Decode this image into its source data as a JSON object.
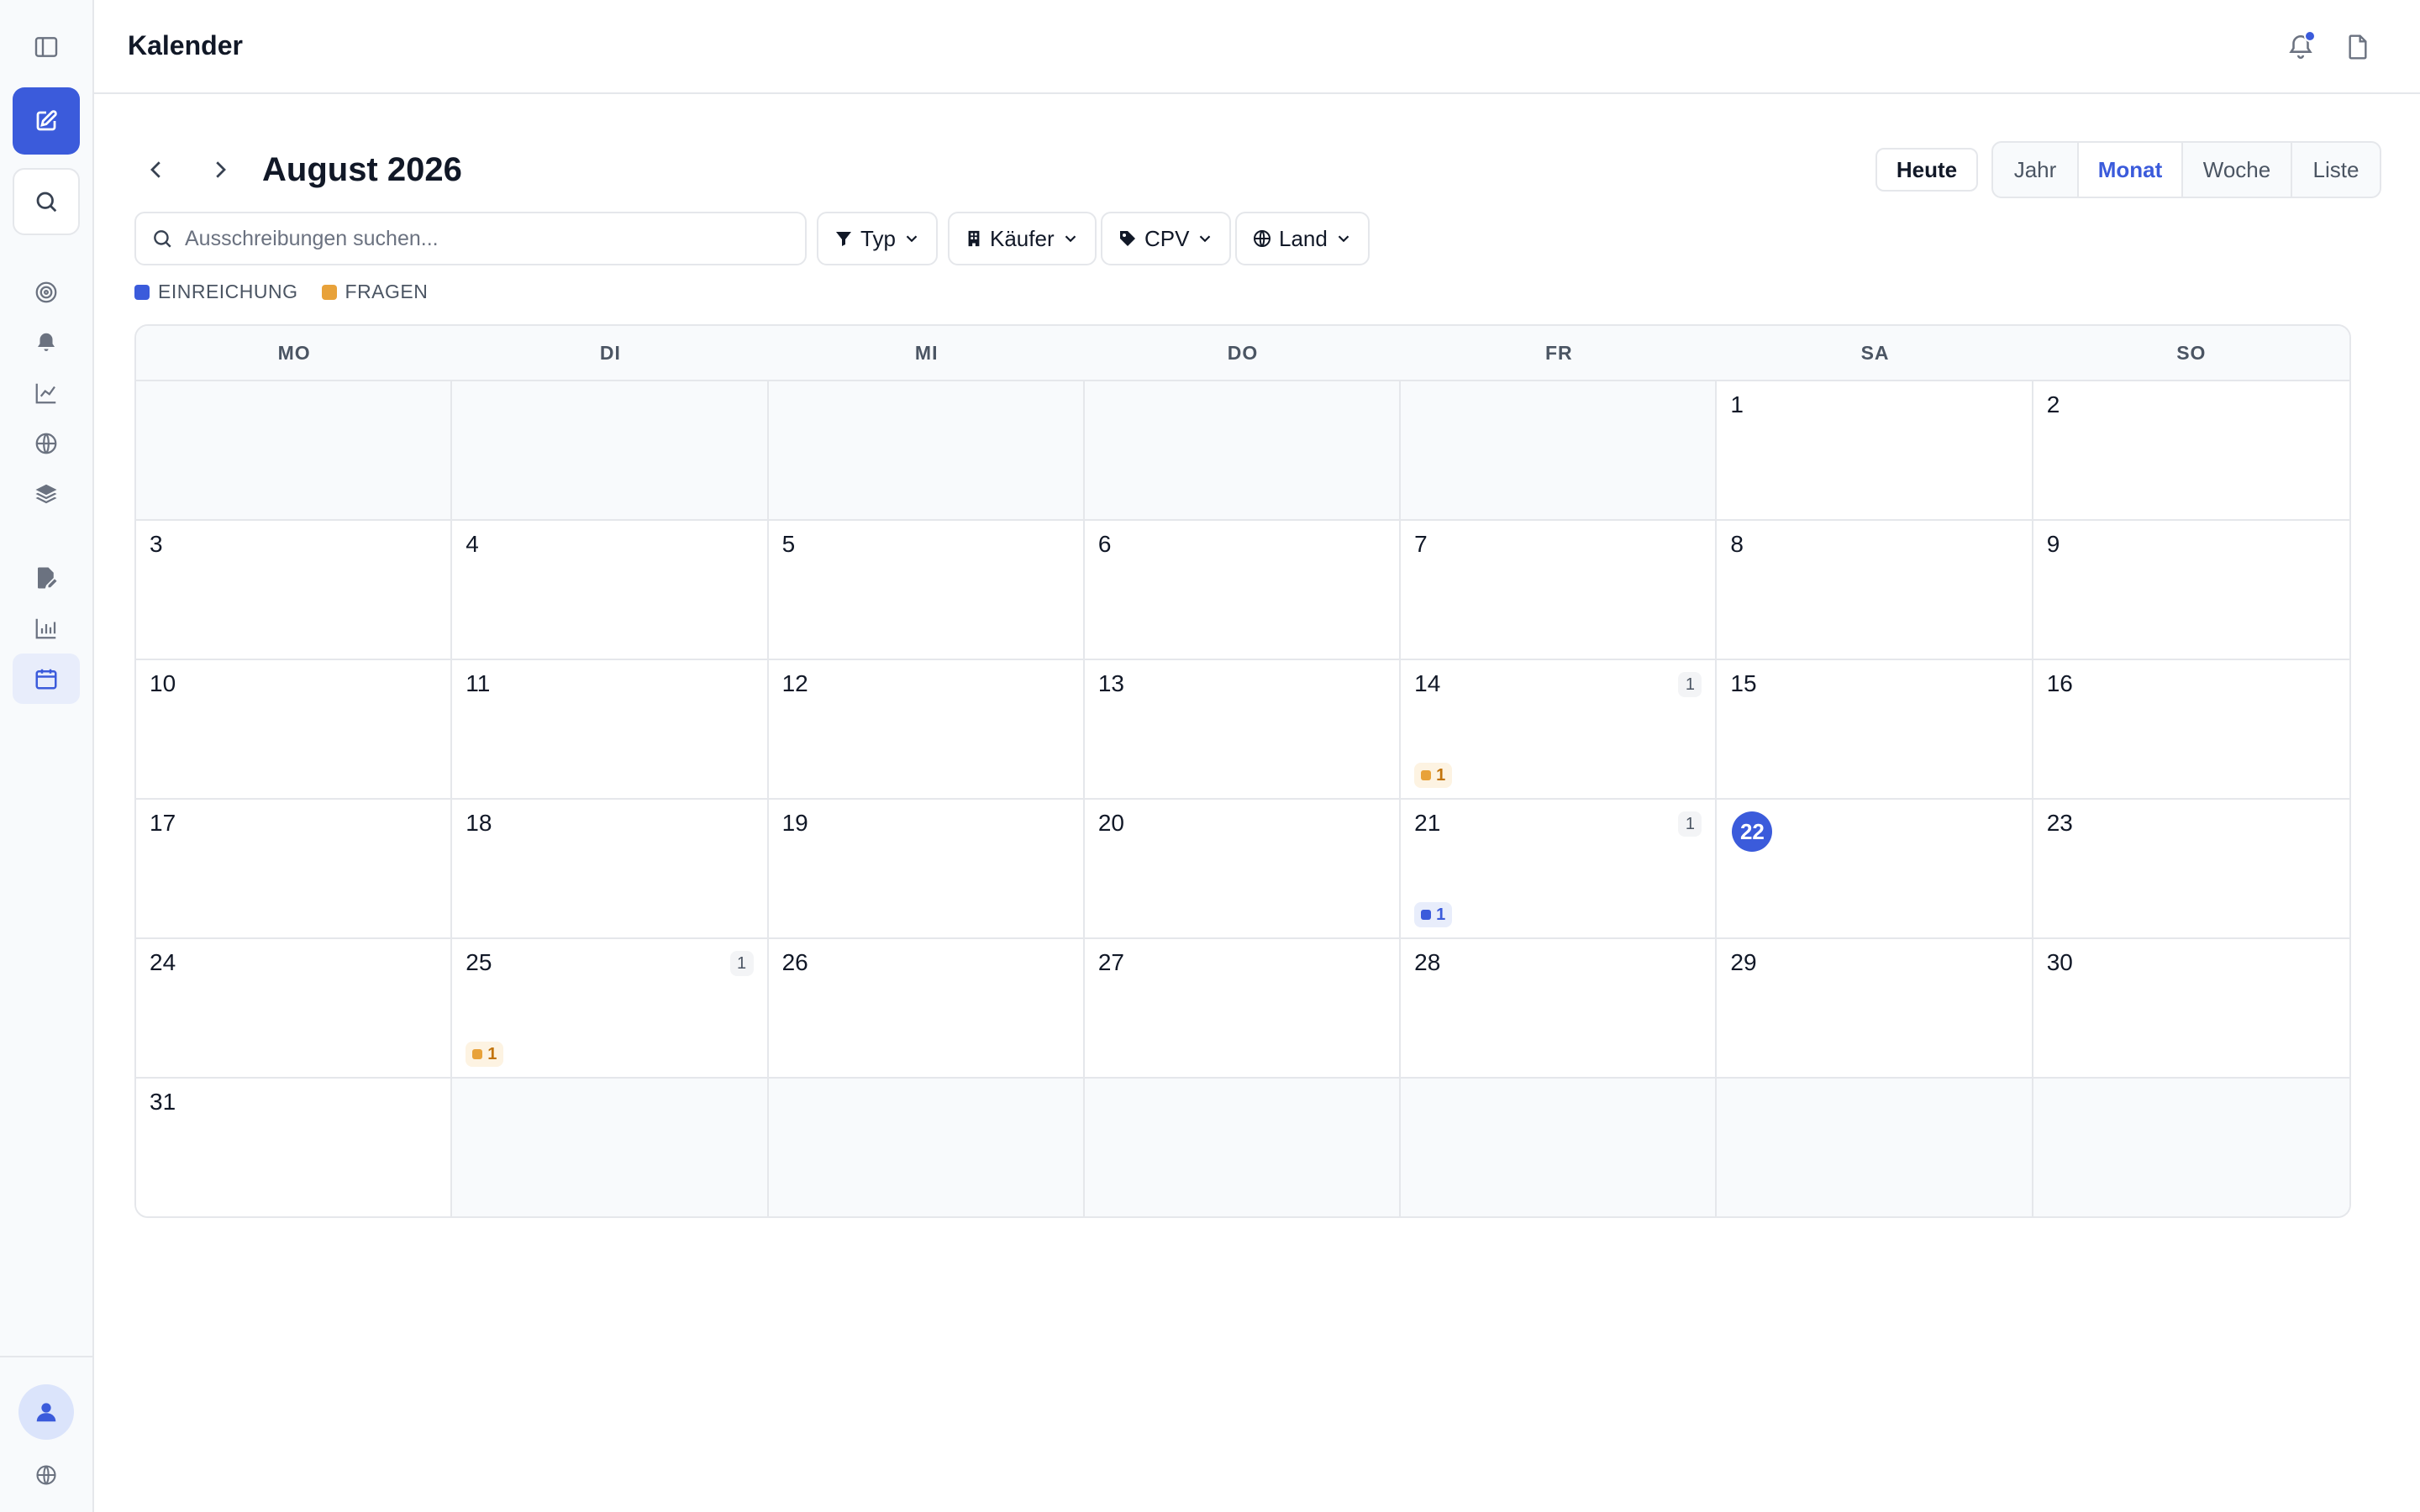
{
  "header": {
    "title": "Kalender"
  },
  "toolbar": {
    "month_title": "August 2026",
    "today_label": "Heute",
    "views": [
      {
        "label": "Jahr",
        "active": false
      },
      {
        "label": "Monat",
        "active": true
      },
      {
        "label": "Woche",
        "active": false
      },
      {
        "label": "Liste",
        "active": false
      }
    ]
  },
  "filters": {
    "search_placeholder": "Ausschreibungen suchen...",
    "type_label": "Typ",
    "buyer_label": "Käufer",
    "cpv_label": "CPV",
    "country_label": "Land"
  },
  "legend": [
    {
      "label": "EINREICHUNG",
      "color": "#3b5bdb"
    },
    {
      "label": "FRAGEN",
      "color": "#e8a23a"
    }
  ],
  "weekdays": [
    "MO",
    "DI",
    "MI",
    "DO",
    "FR",
    "SA",
    "SO"
  ],
  "today": 22,
  "days": [
    "",
    "",
    "",
    "",
    "",
    "1",
    "2",
    "3",
    "4",
    "5",
    "6",
    "7",
    "8",
    "9",
    "10",
    "11",
    "12",
    "13",
    "14",
    "15",
    "16",
    "17",
    "18",
    "19",
    "20",
    "21",
    "22",
    "23",
    "24",
    "25",
    "26",
    "27",
    "28",
    "29",
    "30",
    "31",
    "",
    "",
    "",
    "",
    "",
    ""
  ],
  "events": {
    "14": {
      "count": "1",
      "type": "fragen",
      "chip": "1"
    },
    "21": {
      "count": "1",
      "type": "einreichung",
      "chip": "1"
    },
    "25": {
      "count": "1",
      "type": "fragen",
      "chip": "1"
    }
  },
  "colors": {
    "accent": "#3b5bdb",
    "fragen": "#e8a23a"
  }
}
